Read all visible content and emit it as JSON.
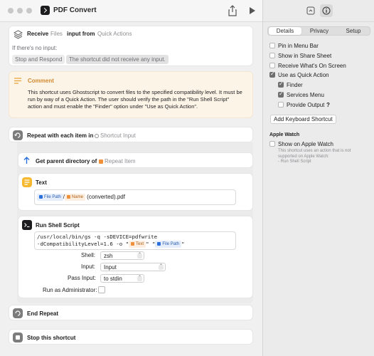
{
  "window": {
    "title": "PDF Convert"
  },
  "receive": {
    "receive_label": "Receive",
    "files_label": "Files",
    "input_from_label": "input from",
    "quick_actions_label": "Quick Actions",
    "no_input_label": "If there's no input:",
    "stop_respond_label": "Stop and Respond",
    "no_input_message": "The shortcut did not receive any input."
  },
  "comment": {
    "title": "Comment",
    "text": "This shortcut uses Ghostscript to convert files to the specified compatibility level. It must be run by way of a Quick Action. The user should verify the path in the \"Run Shell Script\" action and must enable the \"Finder\" option under \"Use as Quick Action\"."
  },
  "repeat": {
    "label": "Repeat with each item in",
    "variable": "Shortcut Input"
  },
  "parent_dir": {
    "label": "Get parent directory of",
    "variable": "Repeat Item"
  },
  "text_action": {
    "title": "Text",
    "var_file_path": "File Path",
    "slash": "/",
    "var_name": "Name",
    "suffix": "(converted).pdf"
  },
  "shell": {
    "title": "Run Shell Script",
    "script_line1": "/usr/local/bin/gs -q -sDEVICE=pdfwrite",
    "script_line2_pre": "-dCompatibilityLevel=1.6 -o \"",
    "var_text": "Text",
    "script_mid": "\" \"",
    "var_file_path": "File Path",
    "script_end": "\"",
    "shell_label": "Shell:",
    "shell_value": "zsh",
    "input_label": "Input:",
    "input_value": "Input",
    "pass_input_label": "Pass Input:",
    "pass_input_value": "to stdin",
    "run_as_admin_label": "Run as Administrator:"
  },
  "end_repeat": {
    "label": "End Repeat"
  },
  "stop": {
    "label": "Stop this shortcut"
  },
  "sidebar": {
    "tabs": [
      "Details",
      "Privacy",
      "Setup"
    ],
    "active_tab": "Details",
    "options": {
      "pin_menu_bar": "Pin in Menu Bar",
      "show_share_sheet": "Show in Share Sheet",
      "receive_onscreen": "Receive What's On Screen",
      "use_quick_action": "Use as Quick Action",
      "finder": "Finder",
      "services_menu": "Services Menu",
      "provide_output": "Provide Output",
      "help": "?"
    },
    "add_shortcut_button": "Add Keyboard Shortcut",
    "apple_watch_heading": "Apple Watch",
    "show_apple_watch": "Show on Apple Watch",
    "watch_note_line1": "This shortcut uses an action that is not",
    "watch_note_line2": "supported on Apple Watch:",
    "watch_note_line3": "- Run Shell Script"
  },
  "colors": {
    "comment_bg": "#fdf4e8",
    "accent_blue": "#2a6fdb",
    "text_icon_yellow": "#f5b82e",
    "checkbox_on": "#6f6f6f"
  }
}
